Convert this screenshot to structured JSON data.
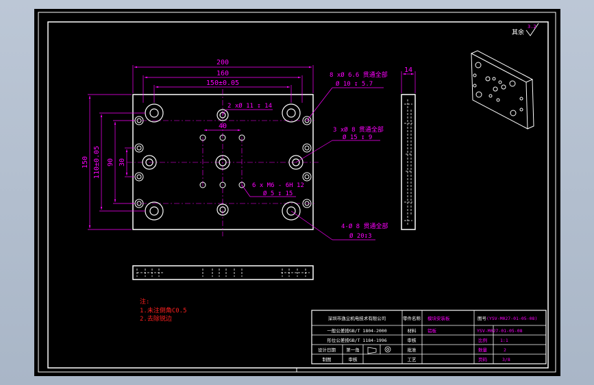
{
  "colors": {
    "background": "#000000",
    "frame": "#ffffff",
    "dimension": "#ff00ff",
    "part": "#ffffff",
    "text_red": "#ff2020"
  },
  "roughness": {
    "label": "其余",
    "value": "3.2"
  },
  "dimensions": {
    "width_200": "200",
    "width_160": "160",
    "width_150": "150±0.05",
    "width_40": "40",
    "height_150": "150",
    "height_110": "110±0.05",
    "height_90": "90",
    "height_30": "30",
    "thickness_14": "14"
  },
  "callouts": {
    "c8_line1": "8 xØ 6.6 贯通全部",
    "c8_line2": "Ø 10 ↧ 5.7",
    "c2": "2 xØ 11 ↧ 14",
    "c3_line1": "3 xØ 8 贯通全部",
    "c3_line2": "Ø 15 ↧ 9",
    "c6_line1": "6 x M6 - 6H 12",
    "c6_line2": "Ø 5 ↧ 15",
    "c4_line1": "4-Ø 8 贯通全部",
    "c4_line2": "Ø 20↧3"
  },
  "notes": {
    "title": "注:",
    "line1": "1.未注倒角C0.5",
    "line2": "2.去除锐边"
  },
  "title_block": {
    "r1_company": "深圳市逸尘机电技术有限公司",
    "r1_label": "零件名称",
    "r1_value": "模块安装板",
    "r1_drawno_label": "图号",
    "r1_drawno": "(YSV-M027-01-05-08)",
    "r2_std": "一般公差按GB/T 1804-2000",
    "r2_label": "材料",
    "r2_value": "铝板",
    "r2_drawno": "YSV-M027-01-05-08",
    "r3_std": "形位公差按GB/T 1184-1996",
    "r3_label": "审核",
    "r3_ratio_label": "比例",
    "r3_ratio": "1:1",
    "r4_label": "设计日期",
    "r4_angle": "第一角",
    "r4_check": "批准",
    "r4_qty_label": "数量",
    "r4_qty": "2",
    "r5_draw": "制图",
    "r5_designer": "审核",
    "r5_proc": "工艺",
    "r5_sheet_label": "页码",
    "r5_sheet": "3/8"
  }
}
